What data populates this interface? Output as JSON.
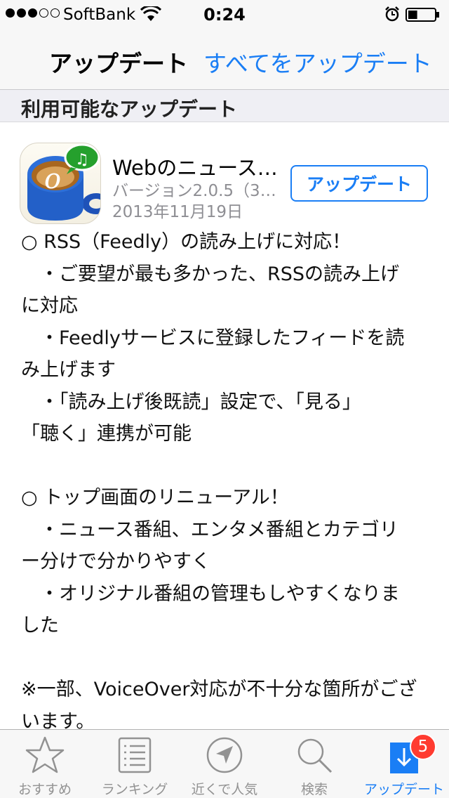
{
  "status_bar": {
    "signal_dots": [
      true,
      true,
      true,
      false,
      false
    ],
    "carrier": "SoftBank",
    "time": "0:24",
    "battery_level": 0.35
  },
  "nav": {
    "title": "アップデート",
    "update_all": "すべてをアップデート"
  },
  "section": {
    "title": "利用可能なアップデート"
  },
  "app": {
    "name": "Webのニュース…",
    "version": "バージョン2.0.5（3…",
    "date": "2013年11月19日",
    "update_label": "アップデート",
    "icon": "coffee-cup-music-icon"
  },
  "notes": [
    "○ RSS（Feedly）の読み上げに対応！",
    "　・ご要望が最も多かった、RSSの読み上げ",
    "に対応",
    "　・Feedlyサービスに登録したフィードを読",
    "み上げます",
    "　・「読み上げ後既読」設定で、「見る」",
    "「聴く」連携が可能",
    "",
    "○ トップ画面のリニューアル！",
    "　・ニュース番組、エンタメ番組とカテゴリ",
    "ー分けで分かりやすく",
    "　・オリジナル番組の管理もしやすくなりま",
    "した",
    "",
    "※一部、VoiceOver対応が不十分な箇所がござ",
    "います。"
  ],
  "tabs": [
    {
      "label": "おすすめ",
      "icon": "star-icon"
    },
    {
      "label": "ランキング",
      "icon": "list-icon"
    },
    {
      "label": "近くで人気",
      "icon": "location-icon"
    },
    {
      "label": "検索",
      "icon": "search-icon"
    },
    {
      "label": "アップデート",
      "icon": "download-icon"
    }
  ],
  "badge": "5",
  "colors": {
    "accent": "#1a7ef5",
    "badge": "#ff3b30",
    "tab_inactive": "#929292"
  }
}
